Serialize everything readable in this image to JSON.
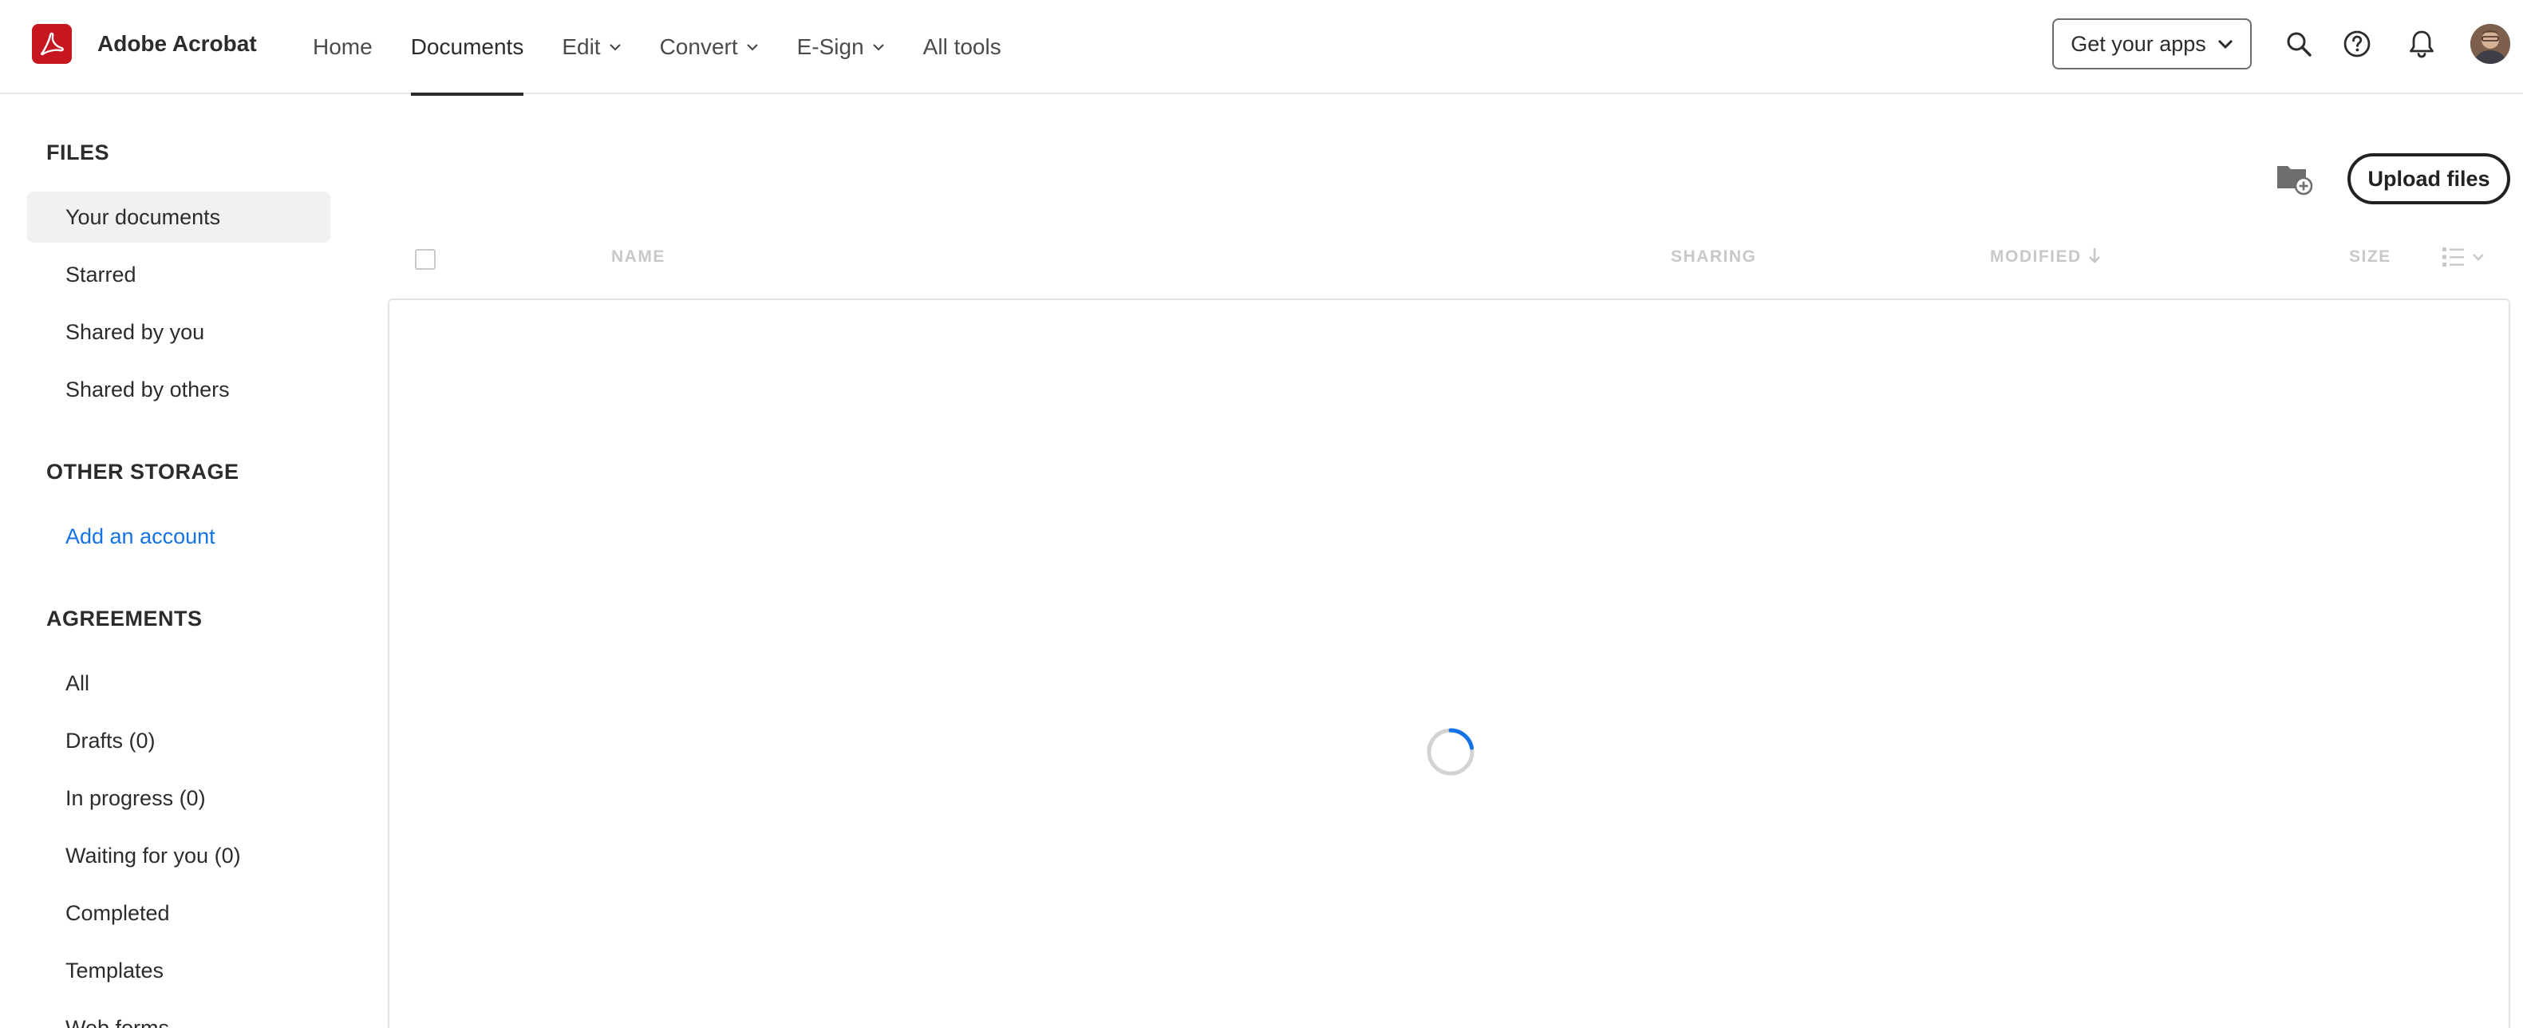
{
  "app": {
    "brand_name": "Adobe Acrobat",
    "brand_color": "#c6161f",
    "accent_color": "#1473e6"
  },
  "nav": {
    "items": [
      {
        "label": "Home",
        "has_menu": false,
        "active": false
      },
      {
        "label": "Documents",
        "has_menu": false,
        "active": true
      },
      {
        "label": "Edit",
        "has_menu": true,
        "active": false
      },
      {
        "label": "Convert",
        "has_menu": true,
        "active": false
      },
      {
        "label": "E-Sign",
        "has_menu": true,
        "active": false
      },
      {
        "label": "All tools",
        "has_menu": false,
        "active": false
      }
    ]
  },
  "header": {
    "get_apps_label": "Get your apps",
    "icons": [
      "search-icon",
      "help-icon",
      "bell-icon",
      "user-avatar"
    ]
  },
  "sidebar": {
    "files_title": "FILES",
    "files_items": [
      {
        "label": "Your documents",
        "active": true
      },
      {
        "label": "Starred",
        "active": false
      },
      {
        "label": "Shared by you",
        "active": false
      },
      {
        "label": "Shared by others",
        "active": false
      }
    ],
    "other_storage_title": "OTHER STORAGE",
    "add_account_label": "Add an account",
    "agreements_title": "AGREEMENTS",
    "agreements_items": [
      {
        "label": "All"
      },
      {
        "label": "Drafts (0)"
      },
      {
        "label": "In progress (0)"
      },
      {
        "label": "Waiting for you (0)"
      },
      {
        "label": "Completed"
      },
      {
        "label": "Templates"
      },
      {
        "label": "Web forms"
      }
    ]
  },
  "main": {
    "new_folder_icon": "folder-add-icon",
    "upload_label": "Upload files",
    "columns": {
      "name": "NAME",
      "sharing": "SHARING",
      "modified": "MODIFIED",
      "size": "SIZE"
    },
    "sort_column": "MODIFIED",
    "sort_direction": "descending",
    "loading": true
  }
}
